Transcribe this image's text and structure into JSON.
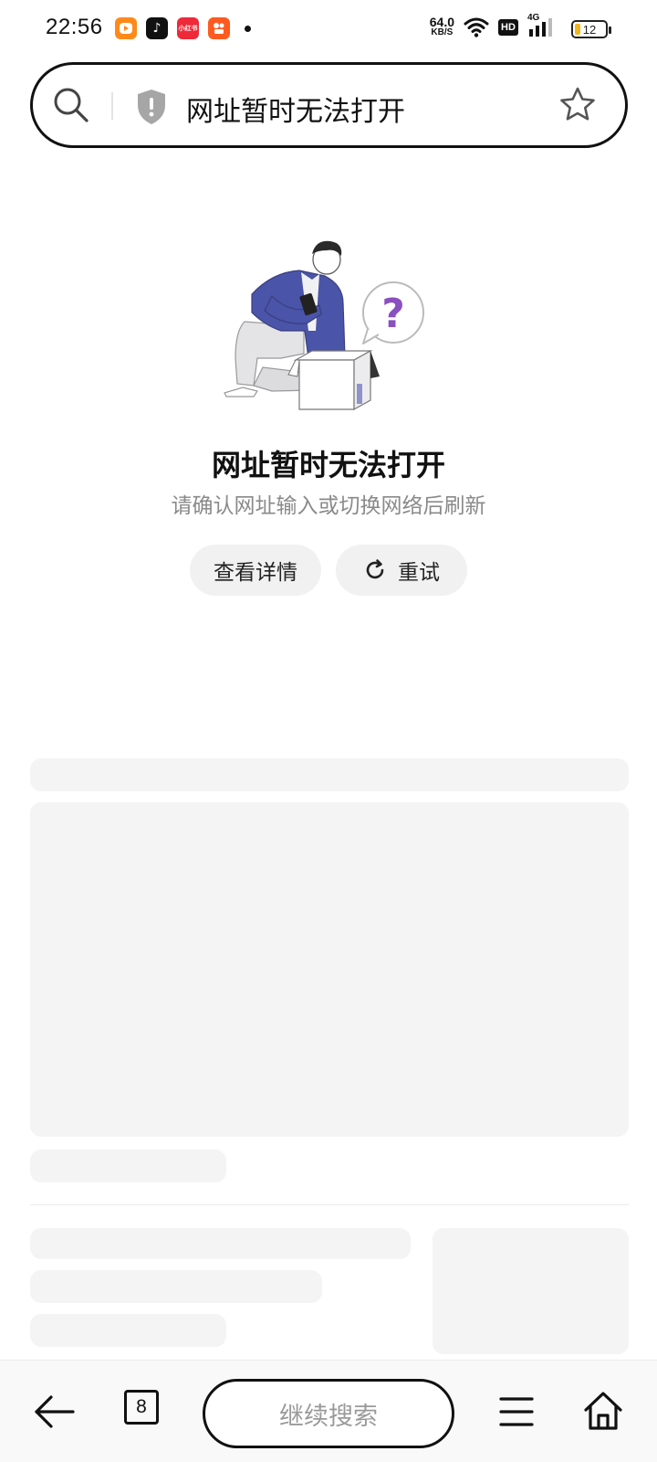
{
  "status_bar": {
    "time": "22:56",
    "app_icons": [
      {
        "name": "video-app-icon",
        "color": "#ff8a1a",
        "label": ""
      },
      {
        "name": "tiktok-app-icon",
        "color": "#111111",
        "label": "♪"
      },
      {
        "name": "xiaohongshu-app-icon",
        "color": "#ee2a3a",
        "label": "小红书"
      },
      {
        "name": "kuaishou-app-icon",
        "color": "#ff5a1f",
        "label": ""
      }
    ],
    "net_speed_value": "64.0",
    "net_speed_unit": "KB/S",
    "hd_label": "HD",
    "network_type": "4G",
    "battery_level": "12",
    "battery_color": "#f2b51b"
  },
  "address_bar": {
    "title": "网址暂时无法打开"
  },
  "error": {
    "title": "网址暂时无法打开",
    "subtitle": "请确认网址输入或切换网络后刷新",
    "details_button": "查看详情",
    "retry_button": "重试",
    "accent_color": "#4a54a8",
    "question_color": "#8a4fc0"
  },
  "bottom_nav": {
    "tab_count": "8",
    "search_placeholder": "继续搜索"
  }
}
